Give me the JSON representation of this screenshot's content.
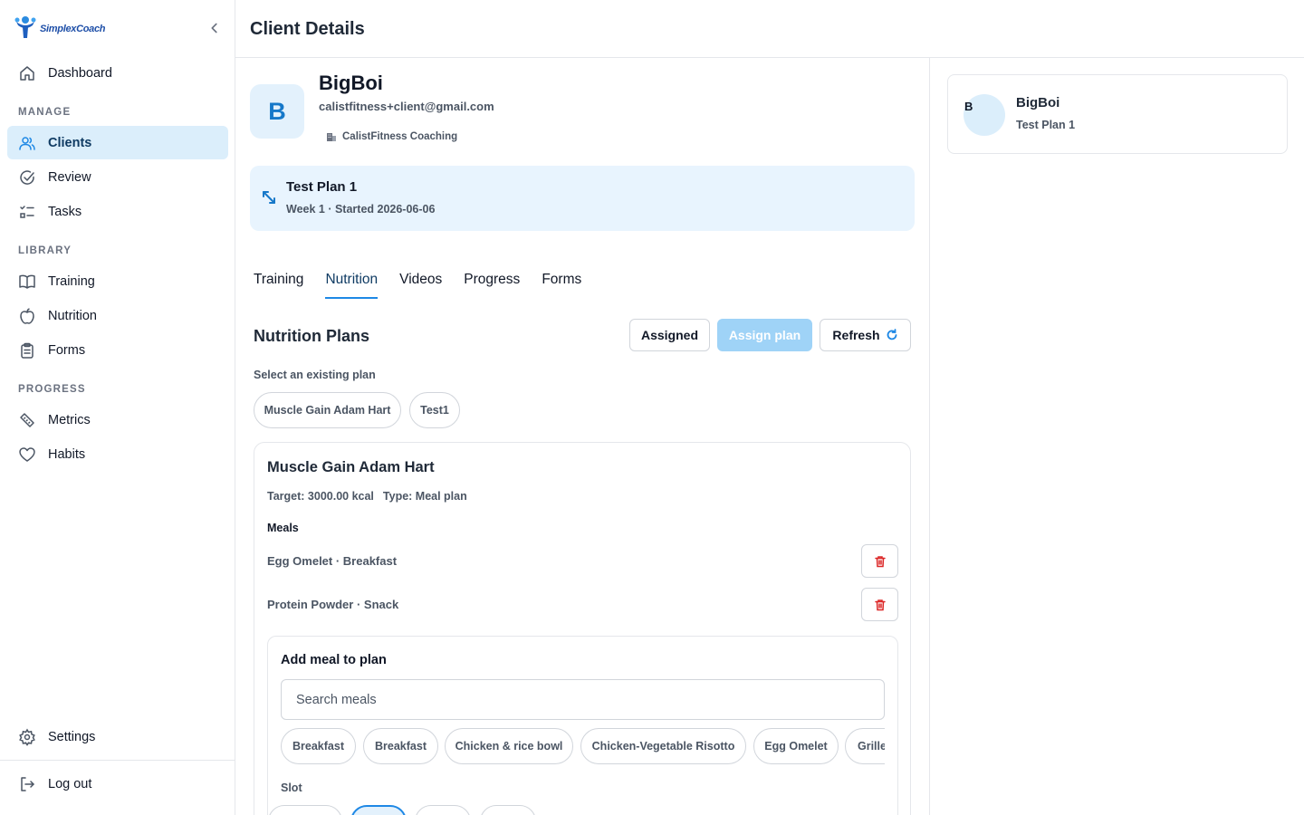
{
  "app": {
    "brand": "SimplexCoach",
    "accent_color": "#1e88e5"
  },
  "sidebar": {
    "dashboard": "Dashboard",
    "manage_heading": "MANAGE",
    "clients": "Clients",
    "review": "Review",
    "tasks": "Tasks",
    "library_heading": "LIBRARY",
    "training": "Training",
    "nutrition": "Nutrition",
    "forms": "Forms",
    "progress_heading": "PROGRESS",
    "metrics": "Metrics",
    "habits": "Habits",
    "settings": "Settings",
    "logout": "Log out",
    "active_item": "Clients"
  },
  "header": {
    "title": "Client Details"
  },
  "client": {
    "initial": "B",
    "name": "BigBoi",
    "email": "calistfitness+client@gmail.com",
    "company": "CalistFitness Coaching"
  },
  "current_plan": {
    "title": "Test Plan 1",
    "subtitle": "Week 1 · Started 2026-06-06"
  },
  "tabs": [
    "Training",
    "Nutrition",
    "Videos",
    "Progress",
    "Forms"
  ],
  "active_tab": "Nutrition",
  "nutrition": {
    "section_title": "Nutrition Plans",
    "assigned_label": "Assigned",
    "assign_label": "Assign plan",
    "refresh_label": "Refresh",
    "select_label": "Select an existing plan",
    "existing_plans": [
      "Muscle Gain Adam Hart",
      "Test1"
    ],
    "selected_plan": {
      "title": "Muscle Gain Adam Hart",
      "target": "Target: 3000.00 kcal",
      "type": "Type: Meal plan",
      "meals_label": "Meals",
      "meals": [
        "Egg Omelet · Breakfast",
        "Protein Powder · Snack"
      ]
    },
    "add_meal": {
      "title": "Add meal to plan",
      "search_placeholder": "Search meals",
      "options": [
        "Breakfast",
        "Breakfast",
        "Chicken & rice bowl",
        "Chicken-Vegetable Risotto",
        "Egg Omelet",
        "Grille"
      ],
      "slot_label": "Slot"
    }
  },
  "right_panel": {
    "client_initial": "B",
    "client_name": "BigBoi",
    "client_plan": "Test Plan 1"
  }
}
